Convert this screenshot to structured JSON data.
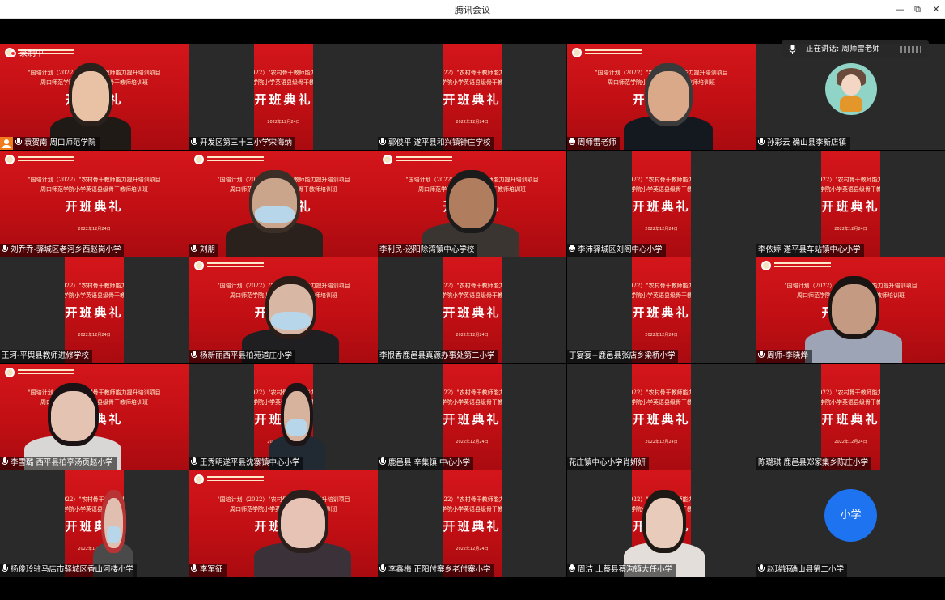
{
  "window": {
    "title": "腾讯会议",
    "minimize_label": "—",
    "restore_label": "⧉",
    "close_label": "✕"
  },
  "recording": {
    "label": "录制中"
  },
  "speaking": {
    "label": "正在讲话: 周师雷老师"
  },
  "slide": {
    "line1": "\"国培计划（2022）\"农村骨干教师能力提升培训项目",
    "line2": "周口师范学院小学英语县级骨干教师培训班",
    "title": "开班典礼",
    "date": "2022年12月24日"
  },
  "participants": [
    {
      "name": "袁贺南 周口师范学院",
      "host": true,
      "mic": true
    },
    {
      "name": "开发区第三十三小学宋海纳",
      "mic": true
    },
    {
      "name": "郭俊平  遂平县和兴镇钟庄学校",
      "mic": true
    },
    {
      "name": "周师雷老师",
      "mic": true
    },
    {
      "name": "孙彩云   确山县李新店镇",
      "mic": true
    },
    {
      "name": "刘乔乔-驿城区老河乡西赵岗小学",
      "mic": true
    },
    {
      "name": "刘朋",
      "mic": true
    },
    {
      "name": "李利民-泌阳除湾镇中心学校",
      "mic": false
    },
    {
      "name": "李沛驿城区刘阁中心小学",
      "mic": true
    },
    {
      "name": "李依婷 遂平县车站镇中心小学",
      "mic": false
    },
    {
      "name": "王珂-平舆县教师进修学校",
      "mic": false
    },
    {
      "name": "杨新丽西平县柏苑道庄小学",
      "mic": true
    },
    {
      "name": "李恨香鹿邑县真源办事处第二小学",
      "mic": false
    },
    {
      "name": "丁宴宴+鹿邑县张店乡梁桥小学",
      "mic": false
    },
    {
      "name": "周师-李晓烨",
      "mic": true
    },
    {
      "name": "李雪璐 西平县柏亭汤页赵小学",
      "mic": true
    },
    {
      "name": "王秀明遂平县沈寨镇中心小学",
      "mic": true
    },
    {
      "name": "鹿邑县 辛集镇 中心小学",
      "mic": true
    },
    {
      "name": "花庄镇中心小学肖妍妍",
      "mic": false
    },
    {
      "name": "陈璐琪 鹿邑县郑家集乡陈庄小学",
      "mic": false
    },
    {
      "name": "杨俊玲驻马店市驿城区香山河楼小学",
      "mic": true
    },
    {
      "name": "李军征",
      "mic": true
    },
    {
      "name": "李鑫梅  正阳付寨乡老付寨小学",
      "mic": true
    },
    {
      "name": "周洁   上蔡县蔡沟镇大任小学",
      "mic": true
    },
    {
      "name": "赵瑞钰确山县第二小学",
      "mic": true
    }
  ],
  "avatar_text": "小学",
  "colors": {
    "slide_red": "#c10f14",
    "host_badge": "#f07c1e",
    "avatar_blue": "#1e73f0",
    "record_dot": "#ff2d2d"
  }
}
